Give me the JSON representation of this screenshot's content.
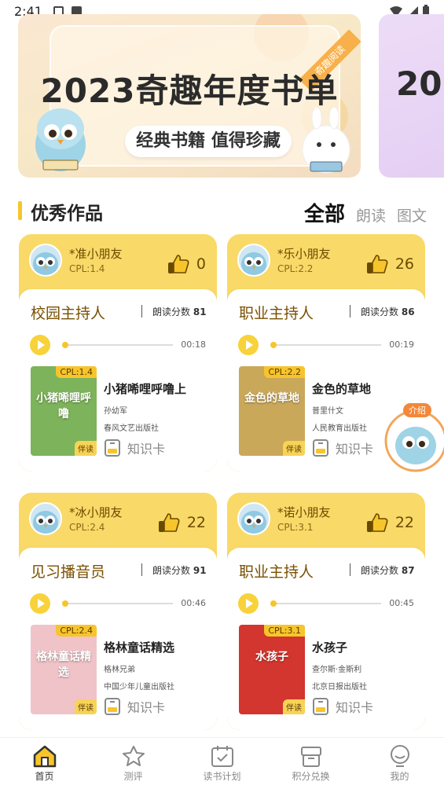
{
  "status_bar": {
    "time": "2:41"
  },
  "banner": {
    "title": "2023奇趣年度书单",
    "subtitle": "经典书籍 值得珍藏",
    "ribbon": "奇趣阅读",
    "next_title_fragment": "20"
  },
  "section": {
    "title": "优秀作品",
    "tabs": [
      {
        "label": "全部",
        "active": true
      },
      {
        "label": "朗读",
        "active": false
      },
      {
        "label": "图文",
        "active": false
      }
    ]
  },
  "works": [
    {
      "user": "*准小朋友",
      "cpl": "CPL:1.4",
      "likes": "0",
      "role": "校园主持人",
      "score_label": "朗读分数",
      "score": "81",
      "duration": "00:18",
      "book": {
        "title": "小猪唏哩呼噜上",
        "author": "孙幼军",
        "publisher": "春风文艺出版社",
        "cpl": "CPL:1.4",
        "badge": "伴读"
      },
      "knowledge": "知识卡"
    },
    {
      "user": "*乐小朋友",
      "cpl": "CPL:2.2",
      "likes": "26",
      "role": "职业主持人",
      "score_label": "朗读分数",
      "score": "86",
      "duration": "00:19",
      "book": {
        "title": "金色的草地",
        "author": "普里什文",
        "publisher": "人民教育出版社",
        "cpl": "CPL:2.2",
        "badge": "伴读"
      },
      "knowledge": "知识卡"
    },
    {
      "user": "*冰小朋友",
      "cpl": "CPL:2.4",
      "likes": "22",
      "role": "见习播音员",
      "score_label": "朗读分数",
      "score": "91",
      "duration": "00:46",
      "book": {
        "title": "格林童话精选",
        "author": "格林兄弟",
        "publisher": "中国少年儿童出版社",
        "cpl": "CPL:2.4",
        "badge": "伴读"
      },
      "knowledge": "知识卡"
    },
    {
      "user": "*诺小朋友",
      "cpl": "CPL:3.1",
      "likes": "22",
      "role": "职业主持人",
      "score_label": "朗读分数",
      "score": "87",
      "duration": "00:45",
      "book": {
        "title": "水孩子",
        "author": "查尔斯·金斯利",
        "publisher": "北京日报出版社",
        "cpl": "CPL:3.1",
        "badge": "伴读"
      },
      "knowledge": "知识卡"
    }
  ],
  "covers": [
    {
      "text": "小猪唏哩呼噜",
      "bg": "#7db35a"
    },
    {
      "text": "金色的草地",
      "bg": "#c9a85a"
    },
    {
      "text": "格林童话精选",
      "bg": "#f0c3c8"
    },
    {
      "text": "水孩子",
      "bg": "#d2362e"
    }
  ],
  "float_badge": "介绍",
  "nav": [
    {
      "label": "首页",
      "icon": "home-icon",
      "active": true
    },
    {
      "label": "测评",
      "icon": "star-icon",
      "active": false
    },
    {
      "label": "读书计划",
      "icon": "calendar-icon",
      "active": false
    },
    {
      "label": "积分兑换",
      "icon": "gift-box-icon",
      "active": false
    },
    {
      "label": "我的",
      "icon": "profile-icon",
      "active": false
    }
  ],
  "colors": {
    "accent": "#f7c52b",
    "card": "#f9d968",
    "role_text": "#7a4f00"
  }
}
